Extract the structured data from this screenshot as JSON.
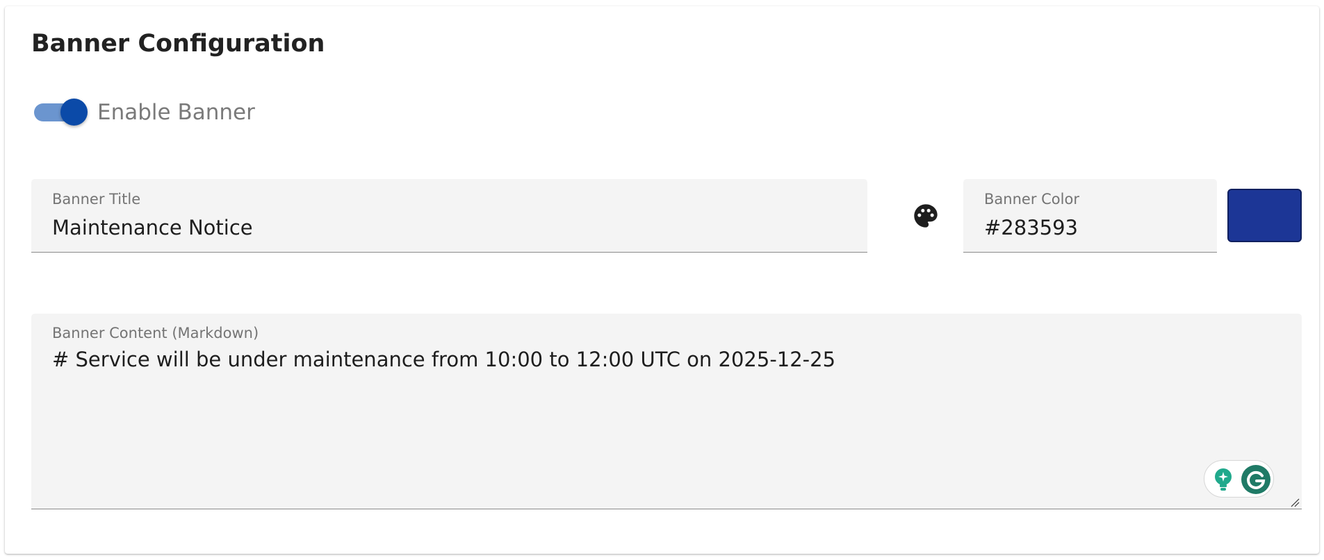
{
  "panel": {
    "title": "Banner Configuration"
  },
  "enable_toggle": {
    "label": "Enable Banner",
    "checked": true,
    "track_color": "#6b95cf",
    "thumb_color": "#0b4aa8"
  },
  "banner_title": {
    "label": "Banner Title",
    "value": "Maintenance Notice"
  },
  "banner_color": {
    "icon": "palette-icon",
    "label": "Banner Color",
    "value": "#283593",
    "swatch_color": "#1c3696"
  },
  "banner_content": {
    "label": "Banner Content (Markdown)",
    "value": "# Service will be under maintenance from 10:00 to 12:00 UTC on 2025-12-25"
  },
  "grammarly_widget": {
    "icons": [
      "lightbulb-icon",
      "grammarly-logo-icon"
    ],
    "accent_color": "#1f7a66"
  }
}
